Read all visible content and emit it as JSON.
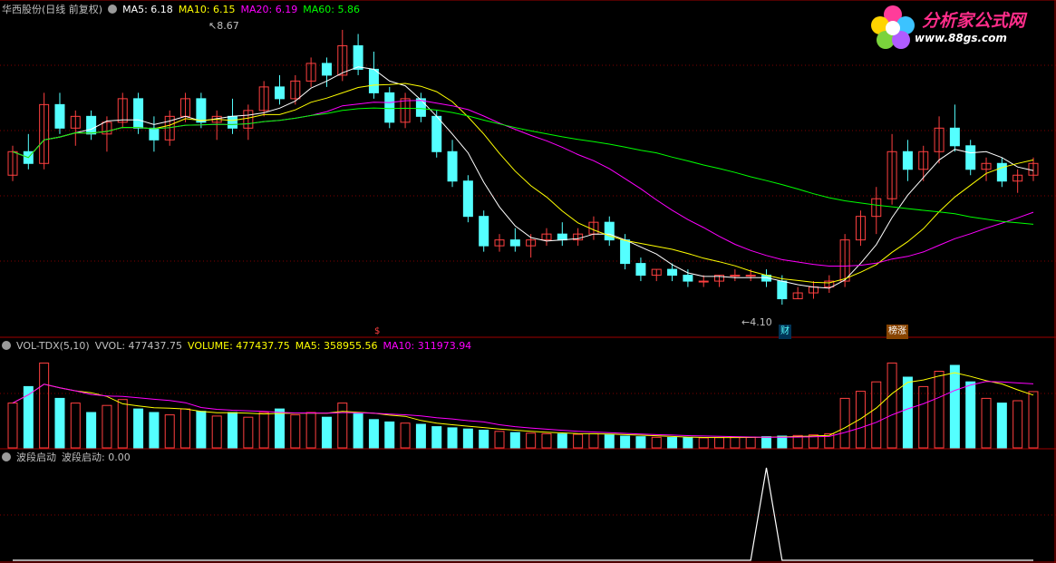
{
  "main_panel": {
    "stock_name": "华西股份(日线 前复权)",
    "ma5": "MA5: 6.18",
    "ma10": "MA10: 6.15",
    "ma20": "MA20: 6.19",
    "ma60": "MA60: 5.86",
    "high_marker": "8.67",
    "low_marker": "4.10",
    "event_tags": [
      "$",
      "财",
      "榜涨"
    ]
  },
  "volume_panel": {
    "indicator": "VOL-TDX(5,10)",
    "vvol": "VVOL: 477437.75",
    "volume": "VOLUME: 477437.75",
    "ma5": "MA5: 358955.56",
    "ma10": "MA10: 311973.94"
  },
  "wave_panel": {
    "indicator": "波段启动",
    "value": "波段启动: 0.00"
  },
  "logo": {
    "title": "分析家公式网",
    "url": "www.88gs.com"
  },
  "colors": {
    "up": "#ff4040",
    "down": "#54ffff",
    "ma5": "#ffffff",
    "ma10": "#ffff00",
    "ma20": "#ff00ff",
    "ma60": "#00ff00",
    "grid": "#800000"
  },
  "chart_data": [
    {
      "type": "candlestick",
      "title": "华西股份(日线 前复权)",
      "ohlc": [
        [
          6.2,
          6.7,
          6.1,
          6.6
        ],
        [
          6.6,
          6.9,
          6.3,
          6.4
        ],
        [
          6.4,
          7.6,
          6.3,
          7.4
        ],
        [
          7.4,
          7.6,
          6.9,
          7.0
        ],
        [
          7.0,
          7.3,
          6.7,
          7.2
        ],
        [
          7.2,
          7.3,
          6.8,
          6.9
        ],
        [
          6.9,
          7.2,
          6.6,
          7.1
        ],
        [
          7.1,
          7.6,
          7.0,
          7.5
        ],
        [
          7.5,
          7.6,
          6.9,
          7.0
        ],
        [
          7.0,
          7.2,
          6.6,
          6.8
        ],
        [
          6.8,
          7.3,
          6.7,
          7.2
        ],
        [
          7.2,
          7.6,
          7.1,
          7.5
        ],
        [
          7.5,
          7.6,
          7.0,
          7.1
        ],
        [
          7.1,
          7.3,
          6.8,
          7.2
        ],
        [
          7.2,
          7.5,
          6.9,
          7.0
        ],
        [
          7.0,
          7.4,
          6.8,
          7.3
        ],
        [
          7.3,
          7.8,
          7.2,
          7.7
        ],
        [
          7.7,
          7.9,
          7.4,
          7.5
        ],
        [
          7.5,
          7.9,
          7.4,
          7.8
        ],
        [
          7.8,
          8.2,
          7.7,
          8.1
        ],
        [
          8.1,
          8.2,
          7.7,
          7.9
        ],
        [
          7.9,
          8.67,
          7.8,
          8.4
        ],
        [
          8.4,
          8.6,
          7.9,
          8.0
        ],
        [
          8.0,
          8.3,
          7.5,
          7.6
        ],
        [
          7.6,
          7.7,
          7.0,
          7.1
        ],
        [
          7.1,
          7.6,
          7.0,
          7.5
        ],
        [
          7.5,
          7.6,
          7.1,
          7.2
        ],
        [
          7.2,
          7.3,
          6.5,
          6.6
        ],
        [
          6.6,
          6.8,
          6.0,
          6.1
        ],
        [
          6.1,
          6.2,
          5.4,
          5.5
        ],
        [
          5.5,
          5.6,
          4.9,
          5.0
        ],
        [
          5.0,
          5.2,
          4.9,
          5.1
        ],
        [
          5.1,
          5.3,
          4.9,
          5.0
        ],
        [
          5.0,
          5.2,
          4.8,
          5.1
        ],
        [
          5.1,
          5.3,
          5.0,
          5.2
        ],
        [
          5.2,
          5.4,
          5.0,
          5.1
        ],
        [
          5.1,
          5.3,
          5.0,
          5.2
        ],
        [
          5.2,
          5.5,
          5.1,
          5.4
        ],
        [
          5.4,
          5.5,
          5.0,
          5.1
        ],
        [
          5.1,
          5.2,
          4.6,
          4.7
        ],
        [
          4.7,
          4.8,
          4.4,
          4.5
        ],
        [
          4.5,
          4.6,
          4.4,
          4.6
        ],
        [
          4.6,
          4.7,
          4.4,
          4.5
        ],
        [
          4.5,
          4.6,
          4.3,
          4.4
        ],
        [
          4.4,
          4.5,
          4.3,
          4.4
        ],
        [
          4.4,
          4.5,
          4.3,
          4.5
        ],
        [
          4.5,
          4.6,
          4.4,
          4.5
        ],
        [
          4.5,
          4.6,
          4.4,
          4.5
        ],
        [
          4.5,
          4.6,
          4.3,
          4.4
        ],
        [
          4.4,
          4.5,
          4.0,
          4.1
        ],
        [
          4.1,
          4.3,
          4.1,
          4.2
        ],
        [
          4.2,
          4.4,
          4.1,
          4.3
        ],
        [
          4.3,
          4.5,
          4.2,
          4.4
        ],
        [
          4.4,
          5.2,
          4.3,
          5.1
        ],
        [
          5.1,
          5.6,
          5.0,
          5.5
        ],
        [
          5.5,
          6.0,
          5.2,
          5.8
        ],
        [
          5.8,
          6.9,
          5.7,
          6.6
        ],
        [
          6.6,
          6.8,
          6.1,
          6.3
        ],
        [
          6.3,
          6.7,
          6.1,
          6.6
        ],
        [
          6.6,
          7.2,
          6.4,
          7.0
        ],
        [
          7.0,
          7.4,
          6.6,
          6.7
        ],
        [
          6.7,
          6.8,
          6.2,
          6.3
        ],
        [
          6.3,
          6.5,
          6.1,
          6.4
        ],
        [
          6.4,
          6.5,
          6.0,
          6.1
        ],
        [
          6.1,
          6.3,
          5.9,
          6.2
        ],
        [
          6.2,
          6.5,
          6.1,
          6.4
        ]
      ]
    },
    {
      "type": "bar",
      "title": "VOL-TDX(5,10)",
      "values": [
        380000,
        520000,
        720000,
        420000,
        380000,
        300000,
        360000,
        410000,
        330000,
        300000,
        280000,
        330000,
        310000,
        270000,
        300000,
        260000,
        300000,
        330000,
        280000,
        300000,
        260000,
        380000,
        290000,
        240000,
        220000,
        210000,
        200000,
        180000,
        170000,
        160000,
        150000,
        140000,
        130000,
        125000,
        120000,
        118000,
        115000,
        120000,
        110000,
        100000,
        95000,
        90000,
        88000,
        86000,
        85000,
        88000,
        90000,
        92000,
        95000,
        100000,
        105000,
        110000,
        120000,
        420000,
        480000,
        560000,
        720000,
        600000,
        520000,
        650000,
        700000,
        560000,
        420000,
        380000,
        400000,
        477437.75
      ]
    },
    {
      "type": "line",
      "title": "波段启动",
      "values": [
        0,
        0,
        0,
        0,
        0,
        0,
        0,
        0,
        0,
        0,
        0,
        0,
        0,
        0,
        0,
        0,
        0,
        0,
        0,
        0,
        0,
        0,
        0,
        0,
        0,
        0,
        0,
        0,
        0,
        0,
        0,
        0,
        0,
        0,
        0,
        0,
        0,
        0,
        0,
        0,
        0,
        0,
        0,
        0,
        0,
        0,
        0,
        0,
        1,
        0,
        0,
        0,
        0,
        0,
        0,
        0,
        0,
        0,
        0,
        0,
        0,
        0,
        0,
        0,
        0,
        0
      ]
    }
  ]
}
